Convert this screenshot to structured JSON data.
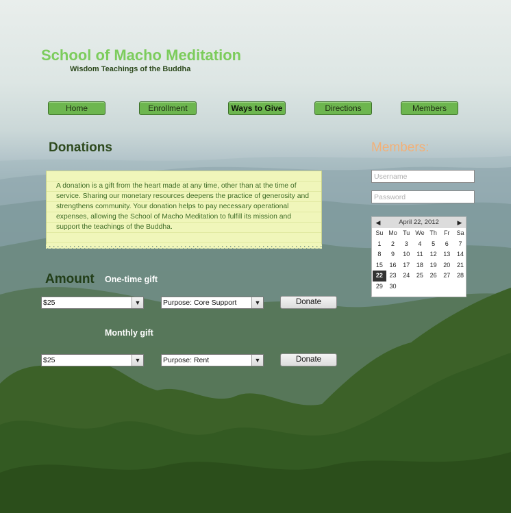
{
  "site": {
    "title": "School of Macho Meditation",
    "tagline": "Wisdom Teachings of the Buddha"
  },
  "nav": {
    "items": [
      {
        "label": "Home",
        "active": false
      },
      {
        "label": "Enrollment",
        "active": false
      },
      {
        "label": "Ways to Give",
        "active": true
      },
      {
        "label": "Directions",
        "active": false
      },
      {
        "label": "Members",
        "active": false
      }
    ]
  },
  "donations": {
    "heading": "Donations",
    "text": "A donation is a gift from the heart made at any time, other than at the time of service. Sharing our monetary resources deepens the practice of generosity and strengthens community. Your donation helps to pay necessary operational expenses, allowing the School of Macho Meditation to fulfill its mission and support the teachings of the Buddha."
  },
  "amount": {
    "heading": "Amount",
    "one_time": {
      "label": "One-time gift",
      "amount_value": "$25",
      "purpose_value": "Purpose: Core Support",
      "button": "Donate"
    },
    "monthly": {
      "label": "Monthly gift",
      "amount_value": "$25",
      "purpose_value": "Purpose: Rent",
      "button": "Donate"
    }
  },
  "members": {
    "heading": "Members:",
    "username_placeholder": "Username",
    "password_placeholder": "Password"
  },
  "calendar": {
    "title": "April 22, 2012",
    "prev_icon": "◀",
    "next_icon": "▶",
    "weekdays": [
      "Su",
      "Mo",
      "Tu",
      "We",
      "Th",
      "Fr",
      "Sa"
    ],
    "days": [
      1,
      2,
      3,
      4,
      5,
      6,
      7,
      8,
      9,
      10,
      11,
      12,
      13,
      14,
      15,
      16,
      17,
      18,
      19,
      20,
      21,
      22,
      23,
      24,
      25,
      26,
      27,
      28,
      29,
      30
    ],
    "selected": 22
  },
  "colors": {
    "title_green": "#7ccc5c",
    "nav_green": "#6db64f",
    "members_orange": "#f2b077",
    "note_yellow": "#f0f6ba"
  },
  "icons": {
    "dropdown": "dropdown-arrow-icon",
    "prev": "prev-month-icon",
    "next": "next-month-icon"
  }
}
